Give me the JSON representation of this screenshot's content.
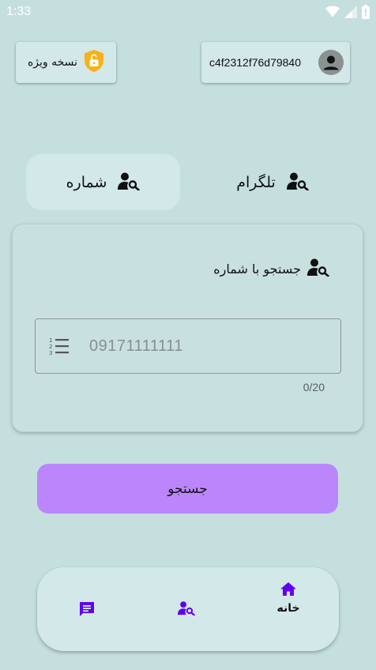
{
  "status_bar": {
    "time": "1:33",
    "icons": [
      "wifi-icon",
      "signal-icon",
      "battery-icon"
    ]
  },
  "premium": {
    "label": "نسخه ویژه",
    "icon": "unlocked-shield-icon",
    "icon_color": "#f9b115"
  },
  "user": {
    "id": "c4f2312f76d79840",
    "icon": "account-circle-icon"
  },
  "tabs": [
    {
      "label": "تلگرام",
      "icon": "person-search-icon",
      "selected": false
    },
    {
      "label": "شماره",
      "icon": "person-search-icon",
      "selected": true
    }
  ],
  "search_card": {
    "title": "جستجو با شماره",
    "title_icon": "person-search-icon",
    "input_value": "",
    "input_placeholder": "09171111111",
    "input_icon": "format-list-numbered-icon",
    "counter": "0/20"
  },
  "search_button": {
    "label": "جستجو",
    "color": "#bb86fc"
  },
  "bottom_nav": {
    "accent_color": "#6200ee",
    "items": [
      {
        "label": "خانه",
        "icon": "home-icon",
        "selected": true
      },
      {
        "label": "",
        "icon": "person-search-icon",
        "selected": false
      },
      {
        "label": "",
        "icon": "chat-icon",
        "selected": false
      }
    ]
  },
  "colors": {
    "background": "#c5dfdf",
    "surface": "#d3e8e8"
  }
}
